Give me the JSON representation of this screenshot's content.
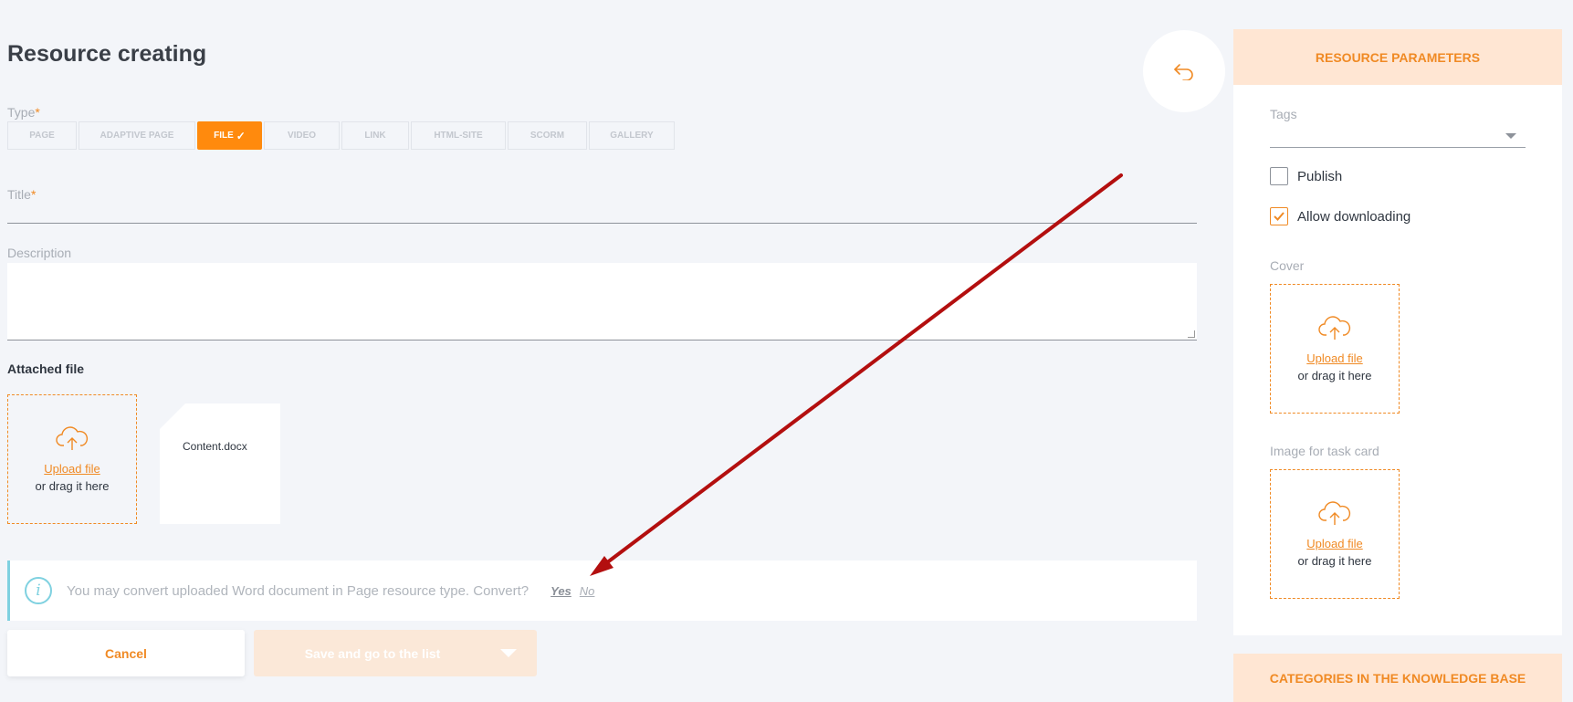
{
  "page": {
    "title": "Resource creating",
    "back_icon": "undo-arrow-icon"
  },
  "form": {
    "type_label": "Type",
    "required_mark": "*",
    "types": [
      {
        "label": "PAGE",
        "active": false
      },
      {
        "label": "ADAPTIVE PAGE",
        "active": false
      },
      {
        "label": "FILE",
        "active": true
      },
      {
        "label": "VIDEO",
        "active": false
      },
      {
        "label": "LINK",
        "active": false
      },
      {
        "label": "HTML-SITE",
        "active": false
      },
      {
        "label": "SCORM",
        "active": false
      },
      {
        "label": "GALLERY",
        "active": false
      }
    ],
    "title_label": "Title",
    "title_value": "",
    "description_label": "Description",
    "description_value": "",
    "attached_file_label": "Attached file",
    "attached_file_name": "Content.docx"
  },
  "upload": {
    "link_label": "Upload file",
    "hint": "or drag it here",
    "icon": "cloud-upload-icon"
  },
  "notice": {
    "text": "You may convert uploaded Word document in Page resource type. Convert?",
    "yes_label": "Yes",
    "no_label": "No",
    "icon": "info-icon"
  },
  "actions": {
    "cancel_label": "Cancel",
    "save_label": "Save and go to the list"
  },
  "sidebar": {
    "parameters_header": "RESOURCE PARAMETERS",
    "tags_label": "Tags",
    "tags_value": "",
    "publish_label": "Publish",
    "publish_checked": false,
    "allow_downloading_label": "Allow downloading",
    "allow_downloading_checked": true,
    "cover_label": "Cover",
    "task_card_image_label": "Image for task card",
    "categories_header": "CATEGORIES IN THE KNOWLEDGE BASE"
  },
  "colors": {
    "accent": "#f08a24",
    "active_tab": "#ff8a0d",
    "info": "#7fd1e0",
    "annotation_arrow": "#b30f0f"
  }
}
